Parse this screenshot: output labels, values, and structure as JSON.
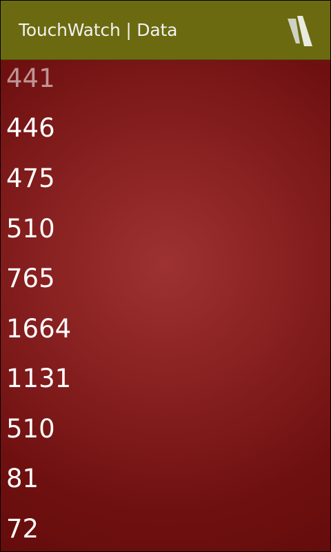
{
  "header": {
    "title": "TouchWatch | Data",
    "icon": "app-logo-icon"
  },
  "rows": [
    {
      "value": "441"
    },
    {
      "value": "446"
    },
    {
      "value": "475"
    },
    {
      "value": "510"
    },
    {
      "value": "765"
    },
    {
      "value": "1664"
    },
    {
      "value": "1131"
    },
    {
      "value": "510"
    },
    {
      "value": "81"
    },
    {
      "value": "72"
    }
  ],
  "colors": {
    "titlebar": "#6b6a10",
    "background": "#8a2222",
    "text": "#ffffff"
  }
}
